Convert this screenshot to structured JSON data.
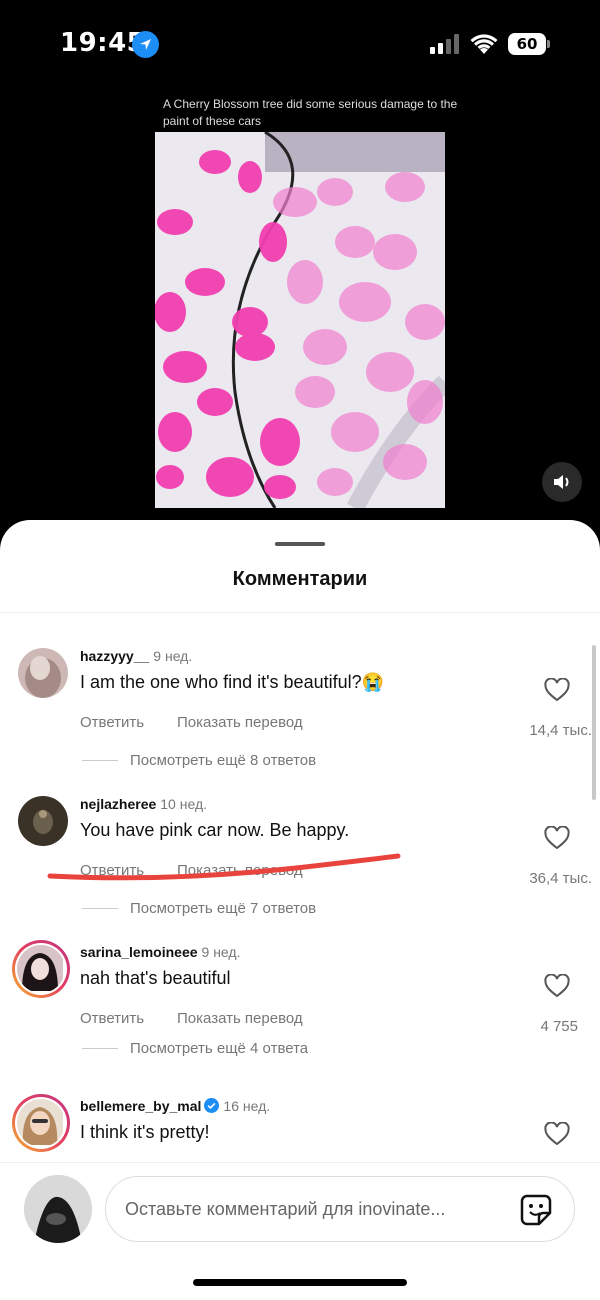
{
  "status_bar": {
    "time": "19:45",
    "battery": "60"
  },
  "post": {
    "caption": "A Cherry Blossom tree did some serious damage to the paint of these cars"
  },
  "sheet": {
    "title": "Комментарии"
  },
  "comments": [
    {
      "username": "hazzyyy__",
      "age": "9 нед.",
      "text": "I am the one who find it's beautiful?😭",
      "reply": "Ответить",
      "translate": "Показать перевод",
      "likes": "14,4 тыс.",
      "more_replies": "Посмотреть ещё 8 ответов"
    },
    {
      "username": "nejlazheree",
      "age": "10 нед.",
      "text": "You have pink car now. Be happy.",
      "reply": "Ответить",
      "translate": "Показать перевод",
      "likes": "36,4 тыс.",
      "more_replies": "Посмотреть ещё 7 ответов"
    },
    {
      "username": "sarina_lemoineee",
      "age": "9 нед.",
      "text": "nah that's beautiful",
      "reply": "Ответить",
      "translate": "Показать перевод",
      "likes": "4 755",
      "more_replies": "Посмотреть ещё 4 ответа"
    },
    {
      "username": "bellemere_by_mal",
      "age": "16 нед.",
      "text": "I think it's pretty!",
      "verified": true
    }
  ],
  "input": {
    "placeholder": "Оставьте комментарий для inovinate..."
  },
  "colors": {
    "accent_blue": "#1e8ef7",
    "petal_pink": "#f23fb0",
    "annotation_red": "#e8433c"
  }
}
